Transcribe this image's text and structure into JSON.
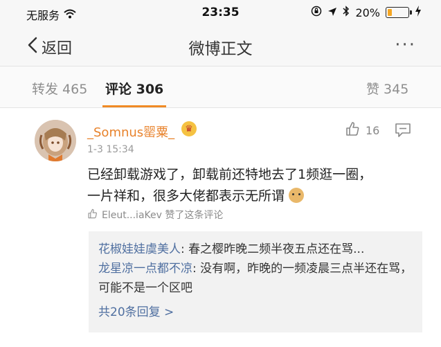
{
  "status_bar": {
    "carrier": "无服务",
    "time": "23:35",
    "battery_percent": "20%",
    "battery_level": 0.2,
    "icons": [
      "wifi-icon",
      "orientation-lock-icon",
      "location-icon",
      "bluetooth-icon",
      "charging-icon"
    ]
  },
  "nav": {
    "back_label": "返回",
    "title": "微博正文",
    "more_label": "···"
  },
  "tabs": {
    "repost": "转发 465",
    "comments": "评论 306",
    "likes": "赞 345"
  },
  "comment": {
    "username": "_Somnus罂粟_",
    "timestamp": "1-3 15:34",
    "like_count": "16",
    "text_line1": "已经卸载游戏了，卸载前还特地去了1频逛一圈，",
    "text_line2": "一片祥和，很多大佬都表示无所谓",
    "liked_by": "Eleut...iaKev 赞了这条评论"
  },
  "replies": {
    "items": [
      {
        "name": "花椒娃娃虞美人",
        "text": ": 春之樱昨晚二频半夜五点还在骂..."
      },
      {
        "name": "龙星凉一点都不凉",
        "text": ": 没有啊，昨晚的一频凌晨三点半还在骂，可能不是一个区吧"
      }
    ],
    "more_label": "共20条回复 >"
  },
  "colors": {
    "accent": "#f08a24",
    "username": "#e8822b",
    "link": "#4f6fa0"
  }
}
